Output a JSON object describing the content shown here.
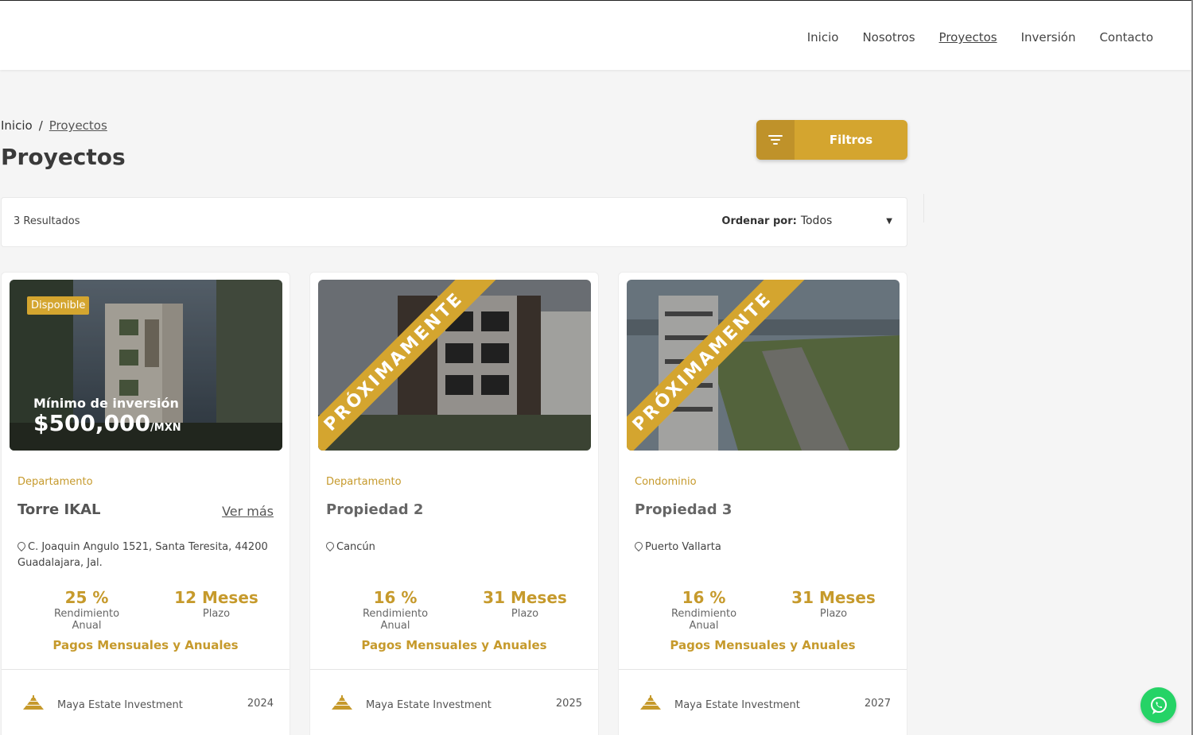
{
  "nav": {
    "items": [
      {
        "label": "Inicio"
      },
      {
        "label": "Nosotros"
      },
      {
        "label": "Proyectos"
      },
      {
        "label": "Inversión"
      },
      {
        "label": "Contacto"
      }
    ]
  },
  "breadcrumb": {
    "home": "Inicio",
    "sep": "/",
    "current": "Proyectos"
  },
  "page_title": "Proyectos",
  "filter_button": {
    "label": "Filtros",
    "icon": "filter-icon"
  },
  "results": {
    "count_label": "3 Resultados",
    "sort_label": "Ordenar por:",
    "sort_value": "Todos"
  },
  "cards": [
    {
      "badge": "Disponible",
      "min_label": "Mínimo de inversión",
      "min_value": "$500,000",
      "min_unit": "/MXN",
      "type": "Departamento",
      "name": "Torre IKAL",
      "more": "Ver más",
      "location": "C. Joaquin Angulo 1521, Santa Teresita, 44200 Guadalajara, Jal.",
      "rate": "25 %",
      "rate_label": "Rendimiento Anual",
      "term": "12 Meses",
      "term_label": "Plazo",
      "payments": "Pagos Mensuales y Anuales",
      "company": "Maya Estate Investment",
      "year": "2024"
    },
    {
      "ribbon": "PRÓXIMAMENTE",
      "type": "Departamento",
      "name": "Propiedad 2",
      "location": "Cancún",
      "rate": "16 %",
      "rate_label": "Rendimiento Anual",
      "term": "31 Meses",
      "term_label": "Plazo",
      "payments": "Pagos Mensuales y Anuales",
      "company": "Maya Estate Investment",
      "year": "2025"
    },
    {
      "ribbon": "PRÓXIMAMENTE",
      "type": "Condominio",
      "name": "Propiedad 3",
      "location": "Puerto Vallarta",
      "rate": "16 %",
      "rate_label": "Rendimiento Anual",
      "term": "31 Meses",
      "term_label": "Plazo",
      "payments": "Pagos Mensuales y Anuales",
      "company": "Maya Estate Investment",
      "year": "2027"
    }
  ],
  "colors": {
    "accent": "#d4a52f",
    "whatsapp": "#25d366"
  }
}
